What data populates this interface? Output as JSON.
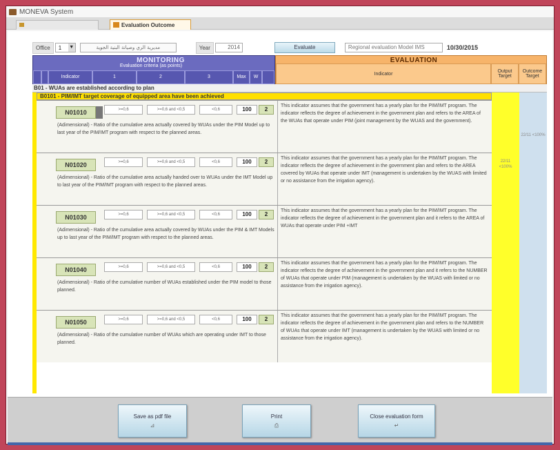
{
  "window": {
    "title": "MONEVA System"
  },
  "tabs": [
    {
      "label": ""
    },
    {
      "label": "Evaluation Outcome"
    }
  ],
  "toolbar": {
    "office_label": "Office",
    "office_value": "1",
    "office_name": "مديرية الري وصيانة البنية الجوية",
    "year_label": "Year",
    "year_value": "2014",
    "evaluate_label": "Evaluate",
    "model_value": "Regional evaluation Model IMS",
    "date": "10/30/2015"
  },
  "monitoring": {
    "title": "MONITORING",
    "criteria_title": "Evaluation criteria (as points)",
    "col_indicator": "Indicator",
    "col_c1": "1",
    "col_c2": "2",
    "col_c3": "3",
    "col_max": "Max",
    "col_w": "W"
  },
  "evaluation": {
    "title": "EVALUATION",
    "col_indicator": "Indicator",
    "col_output": "Output Target",
    "col_outcome": "Outcome Target"
  },
  "section": {
    "label": "B01 - WUAs are established according to plan"
  },
  "subsection": {
    "label": "B0101 - PIM/IMT target coverage of equipped area have been achieved"
  },
  "yellow_value": "22/11 <100%",
  "blue_value": "22/11 <100%",
  "rows": [
    {
      "code": "N01010",
      "c1": ">=0,6",
      "c2": ">=0,6 and <0,5",
      "c3": "<0,6",
      "max": "100",
      "w": "2",
      "desc": "(Adimensional) - Ratio of the cumulative area actually covered by WUAs under the PIM Model up to last year of the PIM/IMT program with respect to the planned areas.",
      "eval": "This indicator assumes that the government has a yearly plan for the PIM/IMT program. The indicator reflects the degree of achievement in the government plan and refers to the AREA of the WUAs that operate under PIM (joint management by the WUAS and the government)."
    },
    {
      "code": "N01020",
      "c1": ">=0,6",
      "c2": ">=0,6 and <0,5",
      "c3": "<0,6",
      "max": "100",
      "w": "2",
      "desc": "(Adimensional) - Ratio of the cumulative area actually handed over to WUAs under the IMT Model up to last year of the PIM/IMT program with respect to the planned areas.",
      "eval": "This indicator assumes that the government has a yearly plan for the PIM/IMT program. The indicator reflects the degree of achievement in the government plan and refers to the AREA covered by WUAs that operate under IMT (management is undertaken by the WUAS with limited or no assistance from the irrigation agency)."
    },
    {
      "code": "N01030",
      "c1": ">=0,6",
      "c2": ">=0,6 and <0,5",
      "c3": "<0,6",
      "max": "100",
      "w": "2",
      "desc": "(Adimensional) - Ratio of the cumulative area actually covered by WUAs under the PIM & IMT Models up to last year of the PIM/IMT program with respect to the planned areas.",
      "eval": "This indicator assumes that the government has a yearly plan for the PIM/IMT program. The indicator reflects the degree of achievement in the government plan and it refers to the AREA of WUAs that operate under PIM +IMT"
    },
    {
      "code": "N01040",
      "c1": ">=0,6",
      "c2": ">=0,6 and <0,5",
      "c3": "<0,6",
      "max": "100",
      "w": "2",
      "desc": "(Adimensional) - Ratio of the cumulative number of WUAs established under the PIM model to those planned.",
      "eval": "This indicator assumes that the government has a yearly plan for the PIM/IMT program. The indicator reflects the degree of achievement in the government plan and it refers to the NUMBER of WUAs that operate under PIM (management is undertaken by the WUAS with limited or no assistance from the irrigation agency)."
    },
    {
      "code": "N01050",
      "c1": ">=0,6",
      "c2": ">=0,6 and <0,5",
      "c3": "<0,6",
      "max": "100",
      "w": "2",
      "desc": "(Adimensional) - Ratio of the cumulative number of WUAs which are operating under IMT to those planned.",
      "eval": "This indicator assumes that the government has a yearly plan for the PIM/IMT program. The indicator reflects the degree of achievement in the government plan and refers to the NUMBER of WUAs that operate under IMT (management is undertaken by the WUAS with limited or no assistance from the irrigation agency)."
    }
  ],
  "buttons": {
    "save_pdf": "Save as pdf file",
    "print": "Print",
    "close": "Close evaluation form"
  },
  "icons": {
    "save": "pdf-icon",
    "print": "print-icon",
    "close": "close-icon"
  }
}
